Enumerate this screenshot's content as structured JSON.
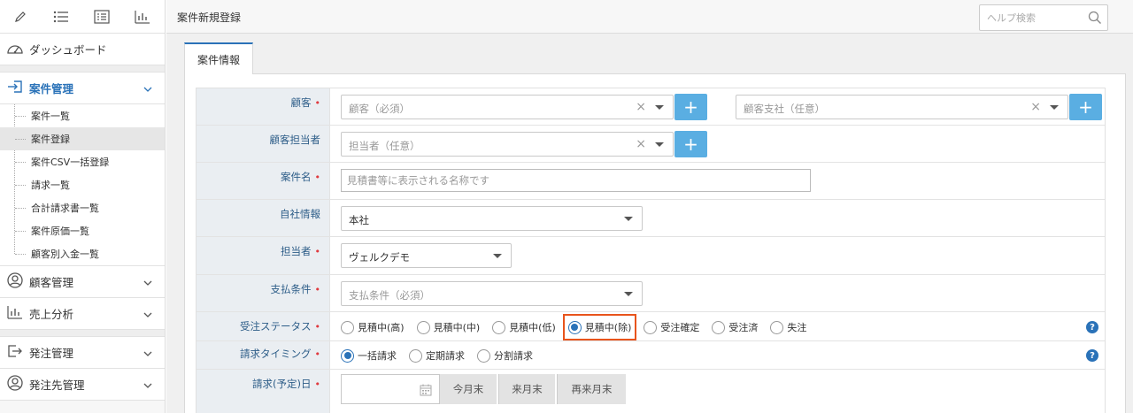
{
  "sidebar": {
    "toolbar_icons": [
      "pencil-icon",
      "list-icon",
      "checklist-icon",
      "bar-chart-icon"
    ],
    "dashboard": "ダッシュボード",
    "anken_kanri": "案件管理",
    "sub_items": [
      "案件一覧",
      "案件登録",
      "案件CSV一括登録",
      "請求一覧",
      "合計請求書一覧",
      "案件原価一覧",
      "顧客別入金一覧"
    ],
    "kokyaku_kanri": "顧客管理",
    "uriage_bunseki": "売上分析",
    "hacchu_kanri": "発注管理",
    "hacchusaki_kanri": "発注先管理"
  },
  "topbar": {
    "title": "案件新規登録",
    "help_placeholder": "ヘルプ検索"
  },
  "main": {
    "tab": "案件情報",
    "colors": {
      "accent": "#2a72b8",
      "plus": "#5aaee2",
      "required": "#e0393e",
      "highlight": "#e8541c"
    }
  },
  "form": {
    "customer": {
      "label": "顧客",
      "placeholder": "顧客（必須）",
      "branch_placeholder": "顧客支社（任意）"
    },
    "contact": {
      "label": "顧客担当者",
      "placeholder": "担当者（任意）"
    },
    "case_name": {
      "label": "案件名",
      "placeholder": "見積書等に表示される名称です"
    },
    "company": {
      "label": "自社情報",
      "value": "本社"
    },
    "staff": {
      "label": "担当者",
      "value": "ヴェルクデモ"
    },
    "payment": {
      "label": "支払条件",
      "placeholder": "支払条件（必須）"
    },
    "order_status": {
      "label": "受注ステータス",
      "options": [
        "見積中(高)",
        "見積中(中)",
        "見積中(低)",
        "見積中(除)",
        "受注確定",
        "受注済",
        "失注"
      ],
      "selected": "見積中(除)"
    },
    "billing_timing": {
      "label": "請求タイミング",
      "options": [
        "一括請求",
        "定期請求",
        "分割請求"
      ],
      "selected": "一括請求"
    },
    "billing_date": {
      "label": "請求(予定)日",
      "buttons": [
        "今月末",
        "来月末",
        "再来月末"
      ]
    }
  }
}
